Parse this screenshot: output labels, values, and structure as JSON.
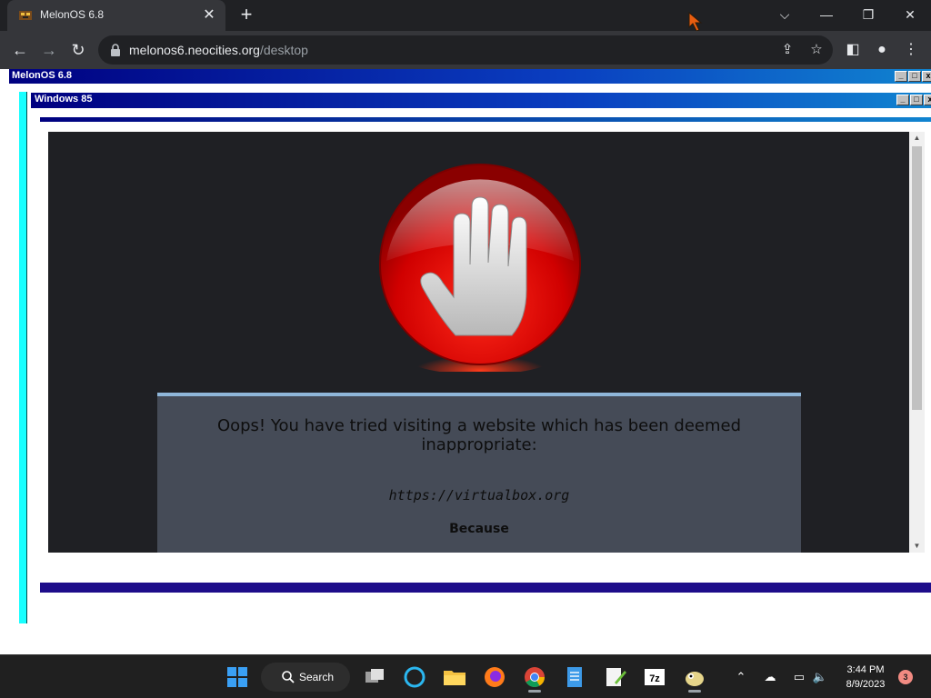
{
  "browser": {
    "tab_title": "MelonOS 6.8",
    "tab_close": "✕",
    "new_tab": "+",
    "url_host": "melonos6.neocities.org",
    "url_path": "/desktop",
    "window_controls": {
      "collapse": "⌵",
      "minimize": "—",
      "restore": "❐",
      "close": "✕"
    }
  },
  "outer_window": {
    "title": "MelonOS 6.8"
  },
  "inner_window": {
    "title": "Windows 85"
  },
  "blocked_page": {
    "message": "Oops! You have tried visiting a website which has been deemed inappropriate:",
    "blocked_url": "https://virtualbox.org",
    "reason_label": "Because"
  },
  "taskbar": {
    "search_label": "Search",
    "time": "3:44 PM",
    "date": "8/9/2023",
    "notification_count": "3",
    "apps": [
      "start-icon",
      "search-icon",
      "task-view-icon",
      "cortana-icon",
      "file-explorer-icon",
      "firefox-icon",
      "chrome-icon",
      "notepad-icon",
      "notepadplusplus-icon",
      "7zip-icon",
      "cuckoo-icon"
    ]
  },
  "colors": {
    "titlebar": "#000080",
    "cyan_bar": "#18ffff",
    "stop_sign": "#e00000",
    "panel": "#454b57",
    "taskbar": "#202020"
  }
}
